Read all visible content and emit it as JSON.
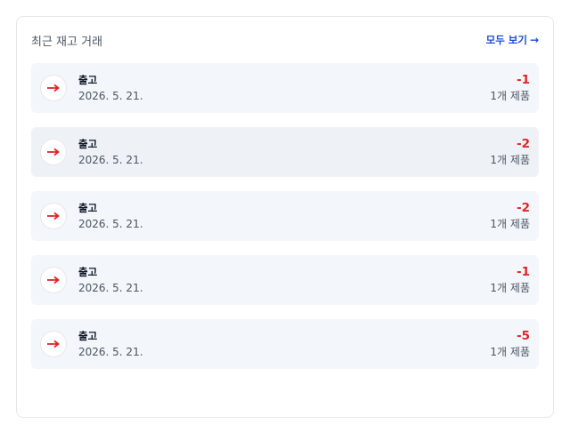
{
  "card": {
    "title": "최근 재고 거래",
    "view_all_label": "모두 보기",
    "view_all_icon": "arrow-right-icon"
  },
  "colors": {
    "outbound": "#dc2626",
    "link": "#1d4ed8"
  },
  "transactions": [
    {
      "icon": "arrow-right-icon",
      "type": "출고",
      "date": "2026. 5. 21.",
      "qty": "-1",
      "count": "1개 제품"
    },
    {
      "icon": "arrow-right-icon",
      "type": "출고",
      "date": "2026. 5. 21.",
      "qty": "-2",
      "count": "1개 제품"
    },
    {
      "icon": "arrow-right-icon",
      "type": "출고",
      "date": "2026. 5. 21.",
      "qty": "-2",
      "count": "1개 제품"
    },
    {
      "icon": "arrow-right-icon",
      "type": "출고",
      "date": "2026. 5. 21.",
      "qty": "-1",
      "count": "1개 제품"
    },
    {
      "icon": "arrow-right-icon",
      "type": "출고",
      "date": "2026. 5. 21.",
      "qty": "-5",
      "count": "1개 제품"
    }
  ]
}
